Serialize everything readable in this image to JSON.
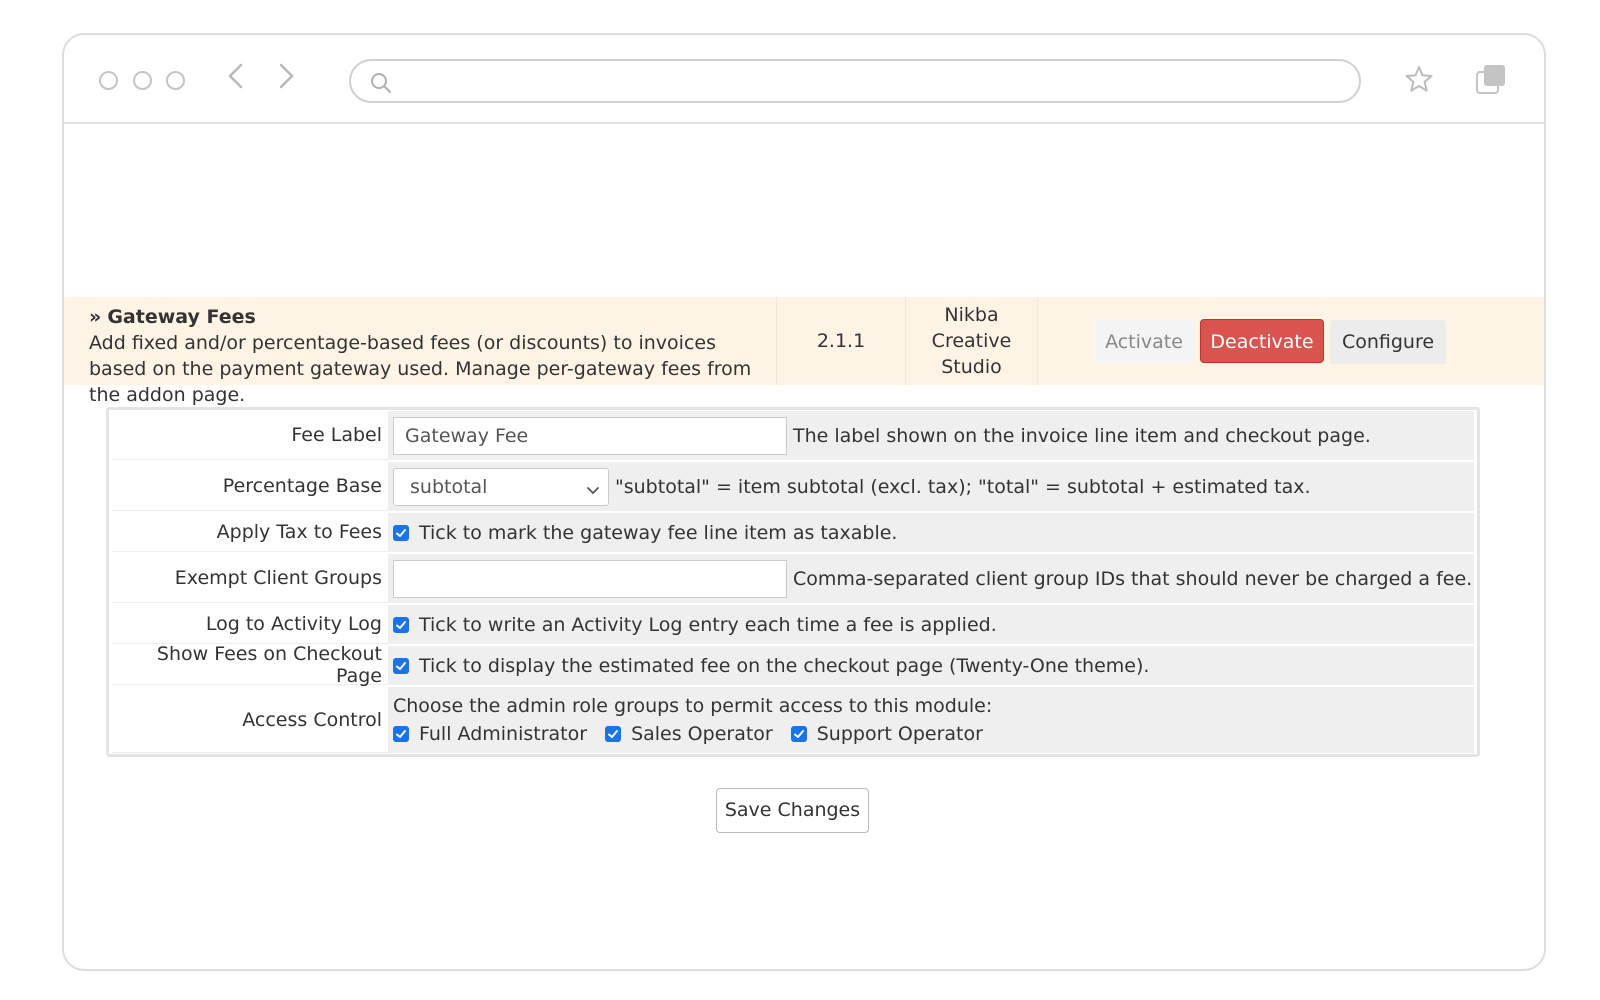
{
  "browser": {
    "url_value": ""
  },
  "addon": {
    "prefix": "»",
    "name": "Gateway Fees",
    "description": "Add fixed and/or percentage-based fees (or discounts) to invoices based on the payment gateway used. Manage per-gateway fees from the addon page.",
    "version": "2.1.1",
    "author_lines": [
      "Nikba",
      "Creative",
      "Studio"
    ],
    "activate_label": "Activate",
    "deactivate_label": "Deactivate",
    "configure_label": "Configure",
    "colors": {
      "row_bg": "#fdf4e6",
      "deactivate": "#d9534f"
    }
  },
  "config": {
    "fee_label": {
      "label": "Fee Label",
      "value": "Gateway Fee",
      "help": "The label shown on the invoice line item and checkout page."
    },
    "percentage_base": {
      "label": "Percentage Base",
      "selected": "subtotal",
      "help": "\"subtotal\" = item subtotal (excl. tax); \"total\" = subtotal + estimated tax."
    },
    "apply_tax": {
      "label": "Apply Tax to Fees",
      "checked": true,
      "help": "Tick to mark the gateway fee line item as taxable."
    },
    "exempt_groups": {
      "label": "Exempt Client Groups",
      "value": "",
      "help": "Comma-separated client group IDs that should never be charged a fee."
    },
    "activity_log": {
      "label": "Log to Activity Log",
      "checked": true,
      "help": "Tick to write an Activity Log entry each time a fee is applied."
    },
    "show_checkout": {
      "label": "Show Fees on Checkout Page",
      "checked": true,
      "help": "Tick to display the estimated fee on the checkout page (Twenty-One theme)."
    },
    "access_control": {
      "label": "Access Control",
      "intro": "Choose the admin role groups to permit access to this module:",
      "options": [
        {
          "label": "Full Administrator",
          "checked": true
        },
        {
          "label": "Sales Operator",
          "checked": true
        },
        {
          "label": "Support Operator",
          "checked": true
        }
      ]
    }
  },
  "save_label": "Save Changes",
  "icons": [
    "search-icon",
    "back-icon",
    "forward-icon",
    "star-icon",
    "tabs-icon",
    "checkbox-checked-icon",
    "chevron-down-icon"
  ]
}
